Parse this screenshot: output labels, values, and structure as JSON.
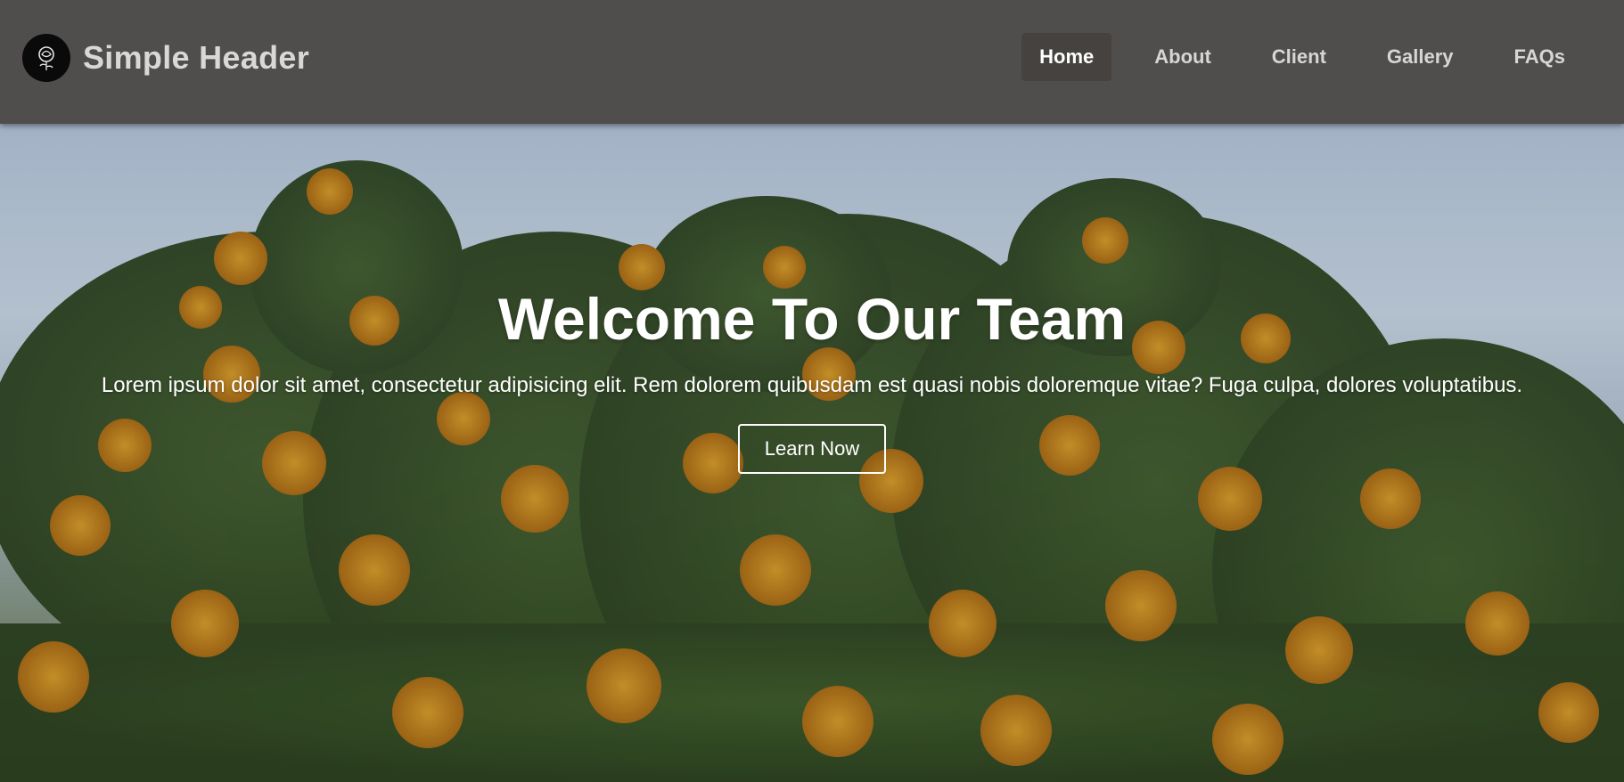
{
  "header": {
    "logo_icon": "rose-icon",
    "title": "Simple Header",
    "background": "#504e4c"
  },
  "nav": {
    "items": [
      {
        "label": "Home",
        "active": true
      },
      {
        "label": "About",
        "active": false
      },
      {
        "label": "Client",
        "active": false
      },
      {
        "label": "Gallery",
        "active": false
      },
      {
        "label": "FAQs",
        "active": false
      }
    ]
  },
  "hero": {
    "title": "Welcome To Our Team",
    "text": "Lorem ipsum dolor sit amet, consectetur adipisicing elit. Rem dolorem quibusdam est quasi nobis doloremque vitae? Fuga culpa, dolores voluptatibus.",
    "button_label": "Learn Now",
    "background_image": "flowering-tree-canopy-against-sky"
  },
  "colors": {
    "text": "#ffffff",
    "nav_text": "#d6d6d6",
    "active_nav_bg": "#45423f"
  }
}
